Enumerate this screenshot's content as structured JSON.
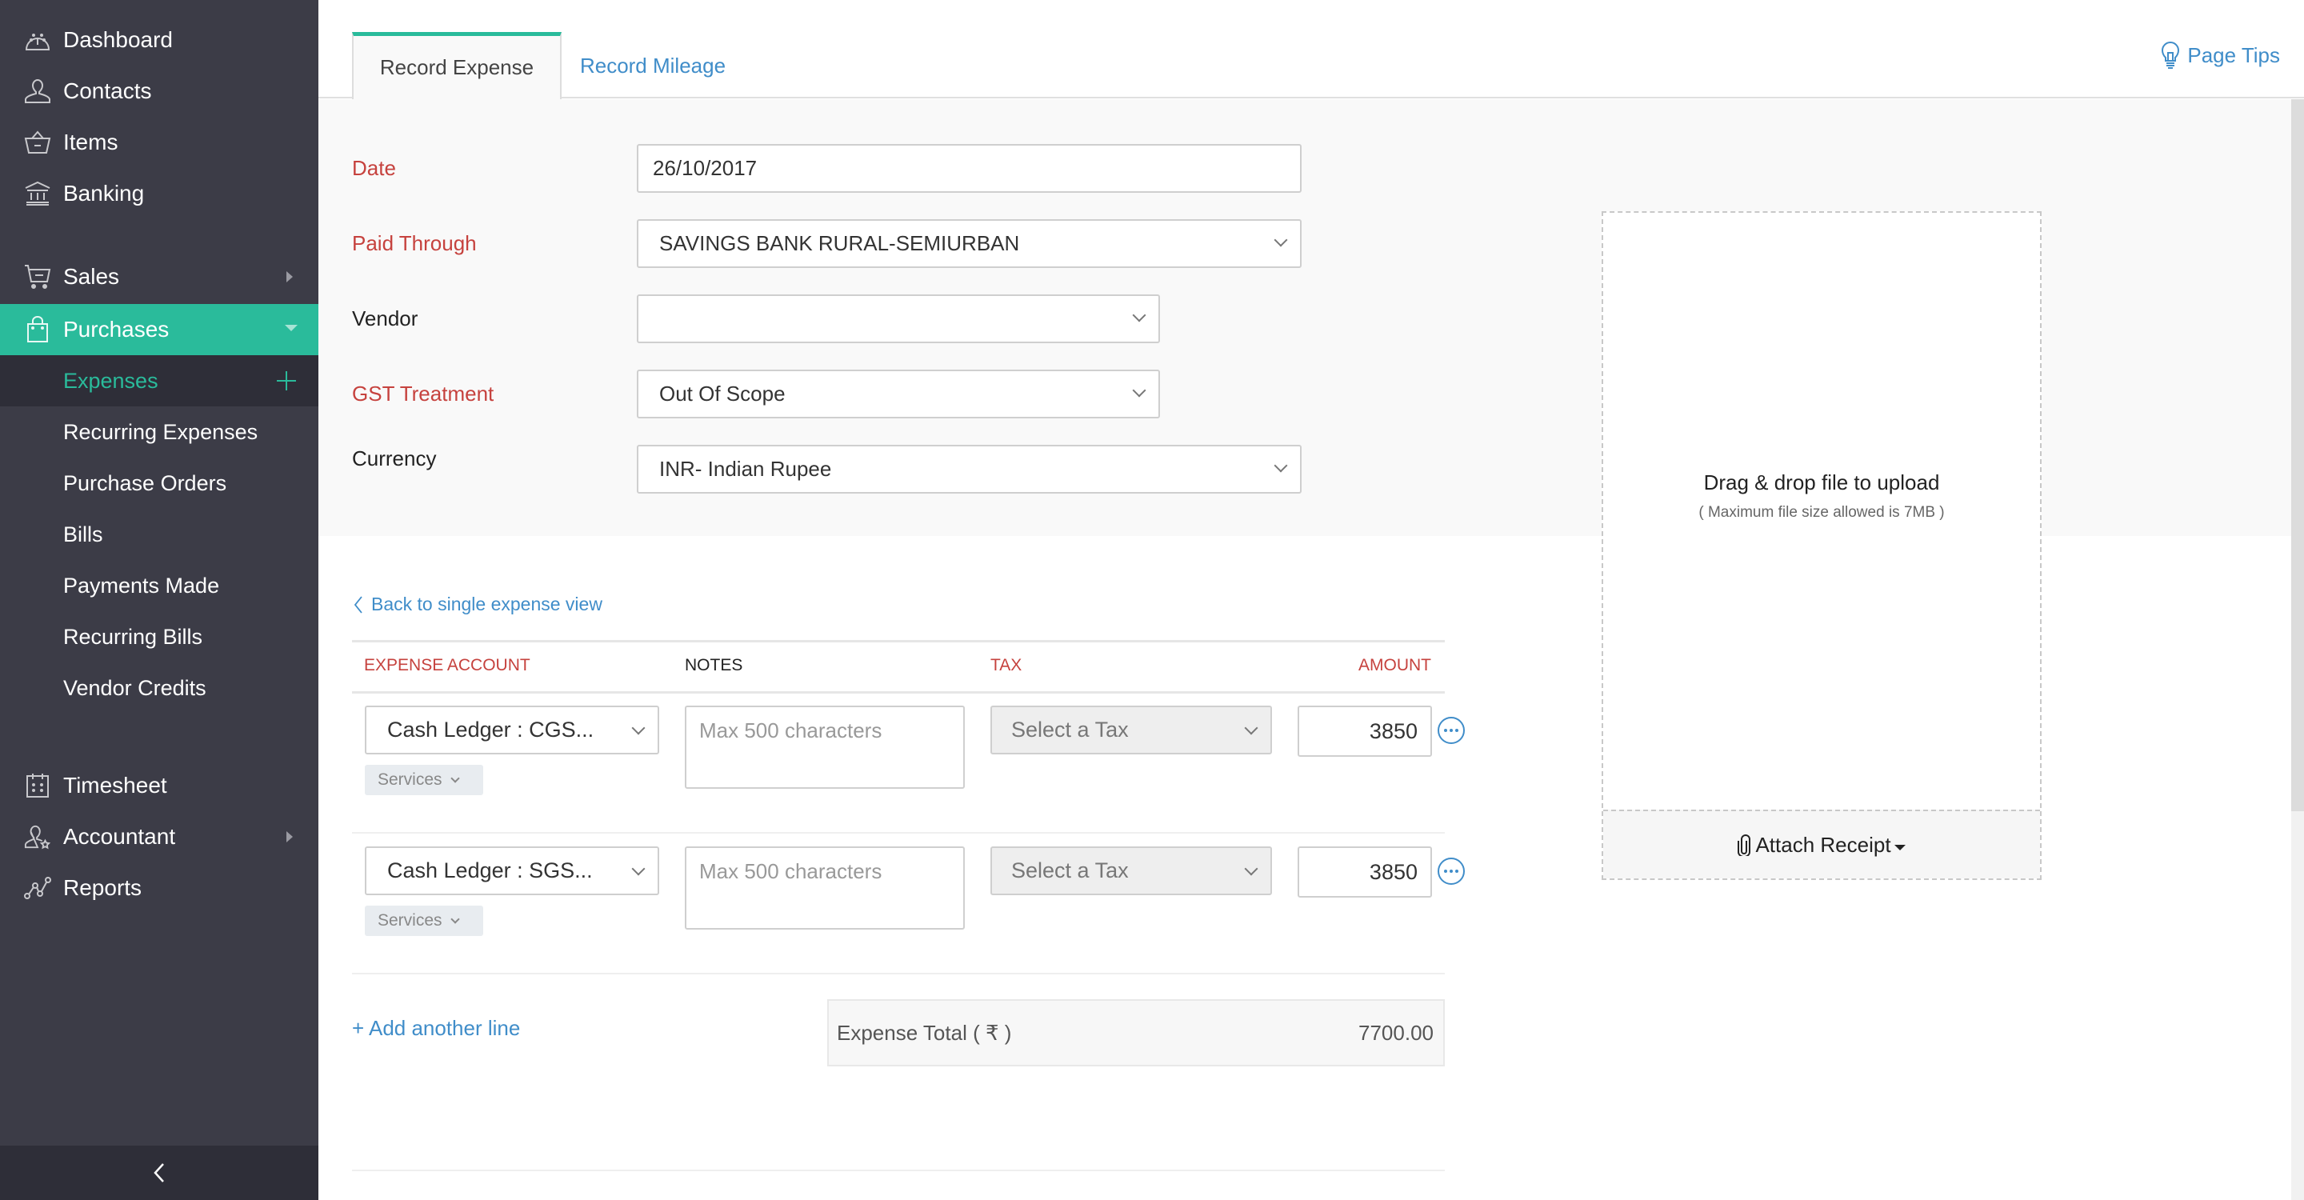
{
  "sidebar": {
    "items": [
      {
        "label": "Dashboard",
        "icon": "dashboard-icon"
      },
      {
        "label": "Contacts",
        "icon": "contacts-icon"
      },
      {
        "label": "Items",
        "icon": "items-basket-icon"
      },
      {
        "label": "Banking",
        "icon": "bank-icon"
      },
      {
        "label": "Sales",
        "icon": "cart-icon"
      },
      {
        "label": "Purchases",
        "icon": "shopping-bag-icon"
      },
      {
        "label": "Timesheet",
        "icon": "calendar-icon"
      },
      {
        "label": "Accountant",
        "icon": "accountant-icon"
      },
      {
        "label": "Reports",
        "icon": "reports-icon"
      }
    ],
    "purchases_sub": [
      {
        "label": "Expenses"
      },
      {
        "label": "Recurring Expenses"
      },
      {
        "label": "Purchase Orders"
      },
      {
        "label": "Bills"
      },
      {
        "label": "Payments Made"
      },
      {
        "label": "Recurring Bills"
      },
      {
        "label": "Vendor Credits"
      }
    ],
    "active_item": "Purchases",
    "current_sub": "Expenses"
  },
  "tabs": [
    {
      "label": "Record Expense",
      "active": true
    },
    {
      "label": "Record Mileage",
      "active": false
    }
  ],
  "page_tips": "Page Tips",
  "form": {
    "date": {
      "label": "Date",
      "value": "26/10/2017"
    },
    "paid_through": {
      "label": "Paid Through",
      "value": "SAVINGS BANK RURAL-SEMIURBAN"
    },
    "vendor": {
      "label": "Vendor",
      "value": ""
    },
    "gst_treatment": {
      "label": "GST Treatment",
      "value": "Out Of Scope"
    },
    "currency": {
      "label": "Currency",
      "value": "INR- Indian Rupee"
    }
  },
  "dropzone": {
    "title": "Drag & drop file to upload",
    "subtitle": "( Maximum file size allowed is 7MB )",
    "attach_label": "Attach Receipt"
  },
  "back_link": "Back to single expense view",
  "table": {
    "headers": [
      "EXPENSE ACCOUNT",
      "NOTES",
      "TAX",
      "AMOUNT"
    ],
    "rows": [
      {
        "account": "Cash Ledger : CGS...",
        "notes_placeholder": "Max 500 characters",
        "tax": "Select a Tax",
        "amount": "3850",
        "tag": "Services"
      },
      {
        "account": "Cash Ledger : SGS...",
        "notes_placeholder": "Max 500 characters",
        "tax": "Select a Tax",
        "amount": "3850",
        "tag": "Services"
      }
    ]
  },
  "add_line": "+ Add another line",
  "total": {
    "label": "Expense Total ( ₹ )",
    "value": "7700.00"
  },
  "colors": {
    "accent": "#2abb9b",
    "sidebar_bg": "#3c3c47",
    "link": "#408dc9",
    "required": "#c6423e"
  }
}
